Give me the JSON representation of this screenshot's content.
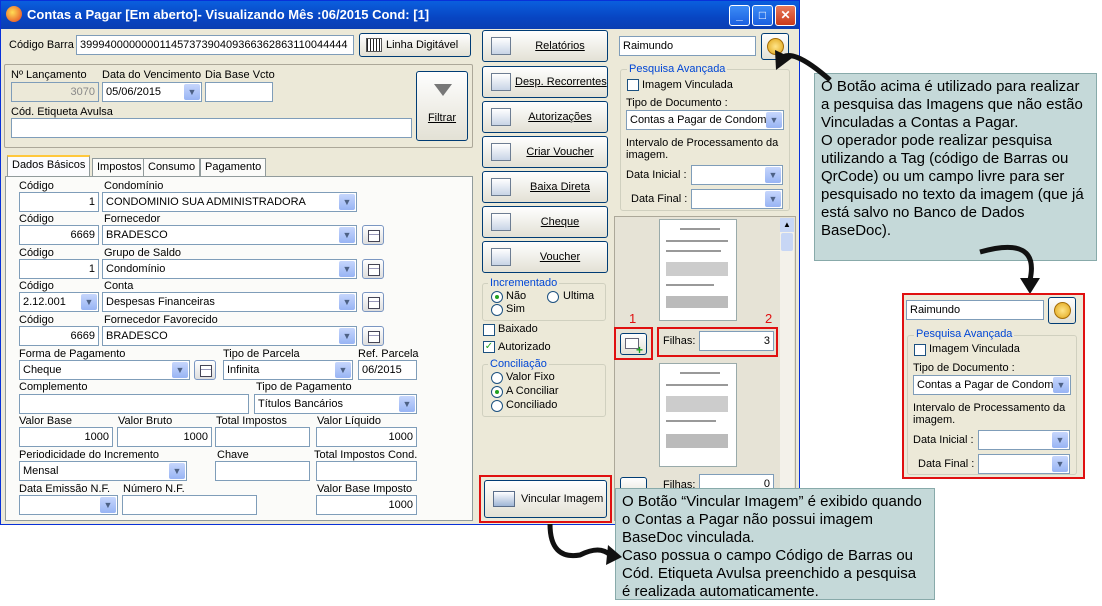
{
  "window": {
    "title": "Contas a Pagar [Em aberto]- Visualizando Mês :06/2015 Cond: [1]"
  },
  "header": {
    "codigo_barra_label": "Código Barra",
    "codigo_barra_value": "39994000000001145737390409366362863110044444",
    "linha_digitavel_label": "Linha Digitável",
    "nro_lancamento_label": "Nº Lançamento",
    "nro_lancamento_value": "3070",
    "data_vencimento_label": "Data do Vencimento",
    "data_vencimento_value": "05/06/2015",
    "dia_base_label": "Dia Base Vcto",
    "cod_etiqueta_label": "Cód. Etiqueta Avulsa",
    "filtrar_label": "Filtrar"
  },
  "tabs": [
    "Dados Básicos",
    "Impostos",
    "Consumo",
    "Pagamento"
  ],
  "form": {
    "codigo_label": "Código",
    "condominio_label": "Condomínio",
    "condominio_code": "1",
    "condominio_value": "CONDOMINIO SUA ADMINISTRADORA",
    "fornecedor_label": "Fornecedor",
    "fornecedor_code": "6669",
    "fornecedor_value": "BRADESCO",
    "grupo_saldo_label": "Grupo de Saldo",
    "grupo_code": "1",
    "grupo_value": "Condomínio",
    "conta_label": "Conta",
    "conta_code": "2.12.001",
    "conta_value": "Despesas Financeiras",
    "favorecido_label": "Fornecedor Favorecido",
    "favorecido_code": "6669",
    "favorecido_value": "BRADESCO",
    "forma_pagamento_label": "Forma de Pagamento",
    "forma_pagamento_value": "Cheque",
    "tipo_parcela_label": "Tipo de Parcela",
    "tipo_parcela_value": "Infinita",
    "ref_parcela_label": "Ref. Parcela",
    "ref_parcela_value": "06/2015",
    "complemento_label": "Complemento",
    "tipo_pagamento_label": "Tipo de Pagamento",
    "tipo_pagamento_value": "Títulos Bancários",
    "valor_base_label": "Valor Base",
    "valor_base_value": "1000",
    "valor_bruto_label": "Valor Bruto",
    "valor_bruto_value": "1000",
    "total_impostos_label": "Total Impostos",
    "valor_liquido_label": "Valor Líquido",
    "valor_liquido_value": "1000",
    "periodicidade_label": "Periodicidade do Incremento",
    "periodicidade_value": "Mensal",
    "chave_label": "Chave",
    "total_impostos_cond_label": "Total Impostos Cond.",
    "data_emissao_label": "Data Emissão N.F.",
    "numero_nf_label": "Número N.F.",
    "valor_base_imposto_label": "Valor Base Imposto",
    "valor_base_imposto_value": "1000"
  },
  "actions": {
    "relatorios": "Relatórios",
    "desp_recorrentes": "Desp. Recorrentes",
    "autorizacoes": "Autorizações",
    "criar_voucher": "Criar Voucher",
    "baixa_direta": "Baixa Direta",
    "cheque": "Cheque",
    "voucher": "Voucher",
    "vincular_imagem": "Vincular Imagem"
  },
  "incrementado": {
    "title": "Incrementado",
    "nao": "Não",
    "ultima": "Ultima",
    "sim": "Sim"
  },
  "baixado_label": "Baixado",
  "autorizado_label": "Autorizado",
  "conciliacao": {
    "title": "Conciliação",
    "valor_fixo": "Valor Fixo",
    "a_conciliar": "A Conciliar",
    "conciliado": "Conciliado"
  },
  "search": {
    "value": "Raimundo",
    "pesquisa_avancada": "Pesquisa Avançada",
    "imagem_vinculada": "Imagem Vinculada",
    "tipo_documento_label": "Tipo de Documento :",
    "tipo_documento_value": "Contas a Pagar de Condomí",
    "intervalo_label": "Intervalo de Processamento da imagem.",
    "data_inicial_label": "Data Inicial :",
    "data_final_label": "Data Final :"
  },
  "images": {
    "filhas_label": "Filhas:",
    "filhas_1": "3",
    "filhas_2": "0",
    "marker_1": "1",
    "marker_2": "2"
  },
  "notes": {
    "search_note": "O Botão acima é utilizado para realizar a pesquisa das Imagens que não estão Vinculadas a Contas a Pagar.\nO operador pode realizar pesquisa utilizando a Tag (código de Barras ou QrCode) ou um campo livre para ser pesquisado no texto da imagem (que já está salvo no Banco de Dados BaseDoc).",
    "vincular_note": "O Botão “Vincular Imagem” é exibido quando o Contas a Pagar não possui imagem BaseDoc vinculada.\nCaso possua o campo Código de Barras ou Cód. Etiqueta Avulsa preenchido a pesquisa é realizada automaticamente."
  },
  "zoom": {
    "value": "Raimundo",
    "pesquisa_avancada": "Pesquisa Avançada",
    "imagem_vinculada": "Imagem Vinculada",
    "tipo_documento_label": "Tipo de Documento :",
    "tipo_documento_value": "Contas a Pagar de Condomí",
    "intervalo_label": "Intervalo de Processamento da imagem.",
    "data_inicial_label": "Data Inicial :",
    "data_final_label": "Data Final :"
  }
}
